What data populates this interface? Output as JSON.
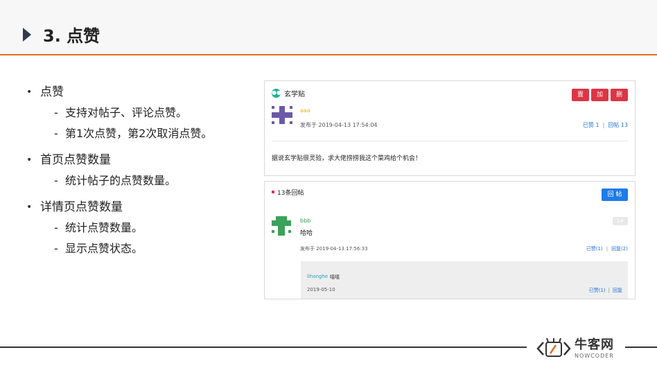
{
  "header": {
    "title": "3. 点赞"
  },
  "bullets": [
    {
      "label": "点赞",
      "subs": [
        "支持对帖子、评论点赞。",
        "第1次点赞，第2次取消点赞。"
      ]
    },
    {
      "label": "首页点赞数量",
      "subs": [
        "统计帖子的点赞数量。"
      ]
    },
    {
      "label": "详情页点赞数量",
      "subs": [
        "统计点赞数量。",
        "显示点赞状态。"
      ]
    }
  ],
  "post": {
    "title": "玄学贴",
    "buttons": {
      "top": "置顶",
      "fine": "加精",
      "delete": "删除"
    },
    "author": "aaa",
    "time": "发布于 2019-04-13 17:54:04",
    "likes": "已赞 1",
    "sep": "|",
    "replies": "回帖 13",
    "content": "据说玄学贴很灵验，求大佬捞捞我这个菜鸡给个机会！"
  },
  "replies_panel": {
    "count": "13条回帖",
    "reply_button": "回 帖",
    "reply": {
      "author": "bbb",
      "floor": "1#",
      "text": "哈哈",
      "time": "发布于 2019-04-13 17:56:33",
      "likes": "已赞(1)",
      "sep": "|",
      "replies": "回复(2)"
    },
    "comment": {
      "user": "lihonghe",
      "text": "嘻嘻",
      "date": "2019-05-10",
      "likes": "已赞(1)",
      "sep": "|",
      "reply": "回复"
    }
  },
  "footer": {
    "logo_cn": "牛客网",
    "logo_en": "NOWCODER"
  },
  "colors": {
    "accent": "#e06c1c",
    "danger": "#dc3545",
    "primary": "#1e7be8"
  }
}
